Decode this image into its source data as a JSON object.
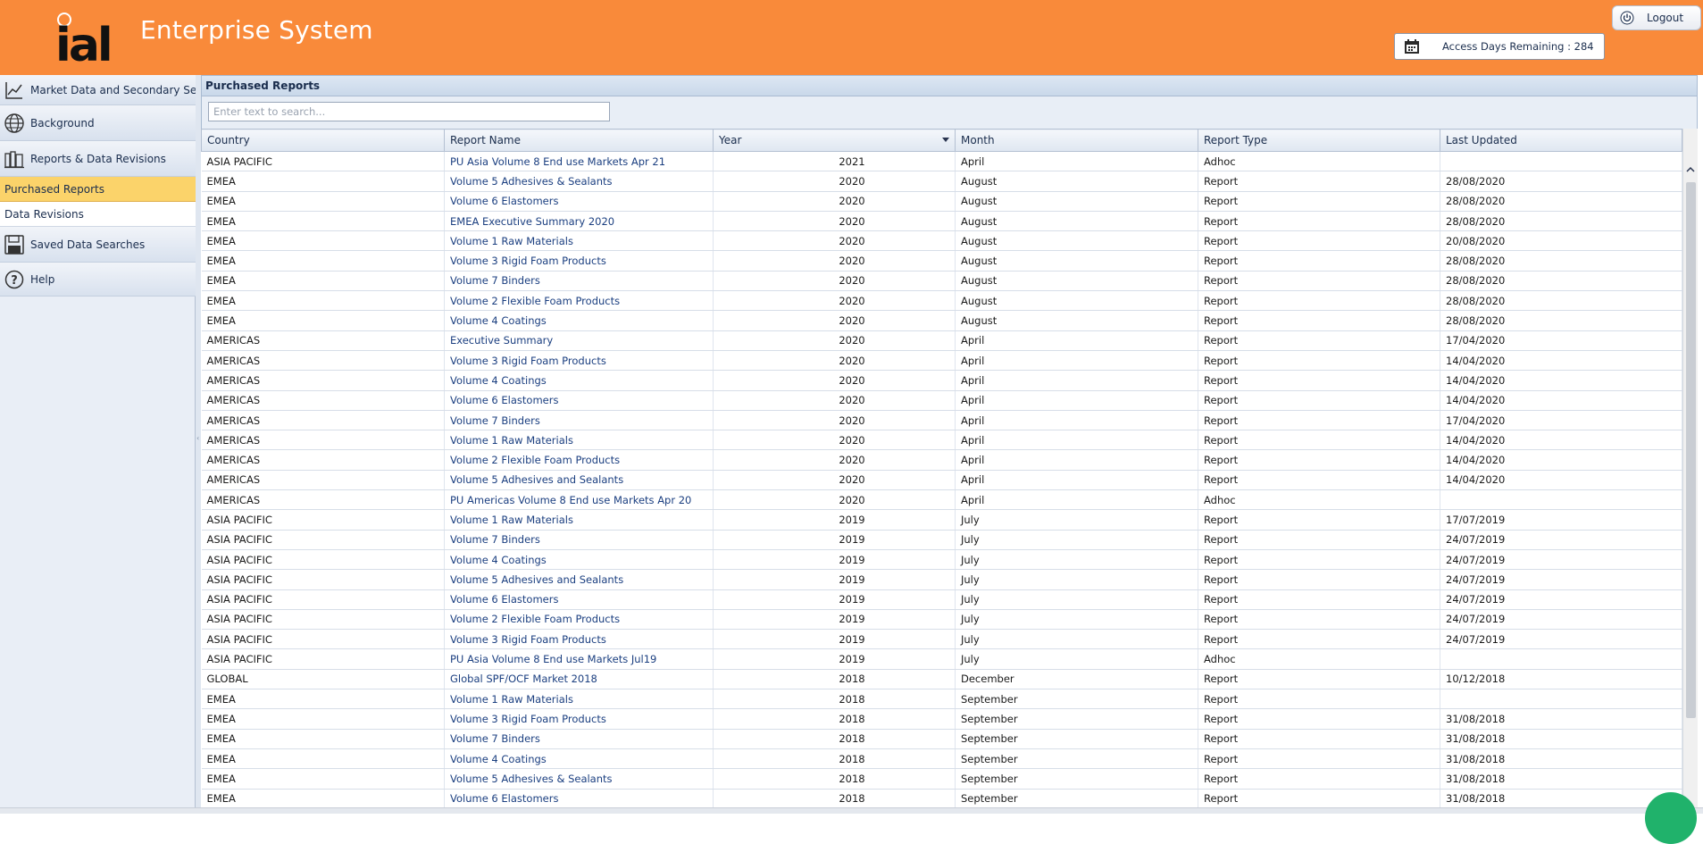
{
  "header": {
    "logo_text": "ial",
    "app_title": "Enterprise System",
    "logout_label": "Logout",
    "access_days_text": "Access Days Remaining : 284",
    "brand_color": "#f98a3a"
  },
  "sidebar": {
    "items": [
      {
        "label": "Market Data and Secondary Segments",
        "icon": "chart-line-icon"
      },
      {
        "label": "Background",
        "icon": "globe-icon"
      },
      {
        "label": "Reports & Data Revisions",
        "icon": "books-icon"
      },
      {
        "label": "Saved Data Searches",
        "icon": "save-icon"
      },
      {
        "label": "Help",
        "icon": "help-icon"
      }
    ],
    "subitems": [
      {
        "label": "Purchased Reports",
        "active": true
      },
      {
        "label": "Data Revisions",
        "active": false
      }
    ],
    "active_color": "#fbd36a"
  },
  "main": {
    "panel_title": "Purchased Reports",
    "search_placeholder": "Enter text to search...",
    "columns": [
      "Country",
      "Report Name",
      "Year",
      "Month",
      "Report Type",
      "Last Updated"
    ],
    "rows": [
      [
        "ASIA PACIFIC",
        "PU Asia Volume 8 End use Markets Apr 21",
        "2021",
        "April",
        "Adhoc",
        ""
      ],
      [
        "EMEA",
        "Volume 5 Adhesives & Sealants",
        "2020",
        "August",
        "Report",
        "28/08/2020"
      ],
      [
        "EMEA",
        "Volume 6 Elastomers",
        "2020",
        "August",
        "Report",
        "28/08/2020"
      ],
      [
        "EMEA",
        "EMEA Executive Summary 2020",
        "2020",
        "August",
        "Report",
        "28/08/2020"
      ],
      [
        "EMEA",
        "Volume 1 Raw Materials",
        "2020",
        "August",
        "Report",
        "20/08/2020"
      ],
      [
        "EMEA",
        "Volume 3 Rigid Foam Products",
        "2020",
        "August",
        "Report",
        "28/08/2020"
      ],
      [
        "EMEA",
        "Volume 7 Binders",
        "2020",
        "August",
        "Report",
        "28/08/2020"
      ],
      [
        "EMEA",
        "Volume 2 Flexible Foam Products",
        "2020",
        "August",
        "Report",
        "28/08/2020"
      ],
      [
        "EMEA",
        "Volume 4 Coatings",
        "2020",
        "August",
        "Report",
        "28/08/2020"
      ],
      [
        "AMERICAS",
        "Executive Summary",
        "2020",
        "April",
        "Report",
        "17/04/2020"
      ],
      [
        "AMERICAS",
        "Volume 3 Rigid Foam Products",
        "2020",
        "April",
        "Report",
        "14/04/2020"
      ],
      [
        "AMERICAS",
        "Volume 4 Coatings",
        "2020",
        "April",
        "Report",
        "14/04/2020"
      ],
      [
        "AMERICAS",
        "Volume 6 Elastomers",
        "2020",
        "April",
        "Report",
        "14/04/2020"
      ],
      [
        "AMERICAS",
        "Volume 7 Binders",
        "2020",
        "April",
        "Report",
        "17/04/2020"
      ],
      [
        "AMERICAS",
        "Volume 1 Raw Materials",
        "2020",
        "April",
        "Report",
        "14/04/2020"
      ],
      [
        "AMERICAS",
        "Volume 2 Flexible Foam Products",
        "2020",
        "April",
        "Report",
        "14/04/2020"
      ],
      [
        "AMERICAS",
        "Volume 5 Adhesives and Sealants",
        "2020",
        "April",
        "Report",
        "14/04/2020"
      ],
      [
        "AMERICAS",
        "PU Americas Volume 8 End use Markets Apr 20",
        "2020",
        "April",
        "Adhoc",
        ""
      ],
      [
        "ASIA PACIFIC",
        "Volume 1 Raw Materials",
        "2019",
        "July",
        "Report",
        "17/07/2019"
      ],
      [
        "ASIA PACIFIC",
        "Volume 7 Binders",
        "2019",
        "July",
        "Report",
        "24/07/2019"
      ],
      [
        "ASIA PACIFIC",
        "Volume 4 Coatings",
        "2019",
        "July",
        "Report",
        "24/07/2019"
      ],
      [
        "ASIA PACIFIC",
        "Volume 5 Adhesives and Sealants",
        "2019",
        "July",
        "Report",
        "24/07/2019"
      ],
      [
        "ASIA PACIFIC",
        "Volume 6 Elastomers",
        "2019",
        "July",
        "Report",
        "24/07/2019"
      ],
      [
        "ASIA PACIFIC",
        "Volume 2 Flexible Foam Products",
        "2019",
        "July",
        "Report",
        "24/07/2019"
      ],
      [
        "ASIA PACIFIC",
        "Volume 3 Rigid Foam Products",
        "2019",
        "July",
        "Report",
        "24/07/2019"
      ],
      [
        "ASIA PACIFIC",
        "PU Asia Volume 8 End use Markets Jul19",
        "2019",
        "July",
        "Adhoc",
        ""
      ],
      [
        "GLOBAL",
        "Global SPF/OCF Market 2018",
        "2018",
        "December",
        "Report",
        "10/12/2018"
      ],
      [
        "EMEA",
        "Volume 1 Raw Materials",
        "2018",
        "September",
        "Report",
        ""
      ],
      [
        "EMEA",
        "Volume 3 Rigid Foam Products",
        "2018",
        "September",
        "Report",
        "31/08/2018"
      ],
      [
        "EMEA",
        "Volume 7 Binders",
        "2018",
        "September",
        "Report",
        "31/08/2018"
      ],
      [
        "EMEA",
        "Volume 4 Coatings",
        "2018",
        "September",
        "Report",
        "31/08/2018"
      ],
      [
        "EMEA",
        "Volume 5 Adhesives & Sealants",
        "2018",
        "September",
        "Report",
        "31/08/2018"
      ],
      [
        "EMEA",
        "Volume 6 Elastomers",
        "2018",
        "September",
        "Report",
        "31/08/2018"
      ]
    ]
  }
}
